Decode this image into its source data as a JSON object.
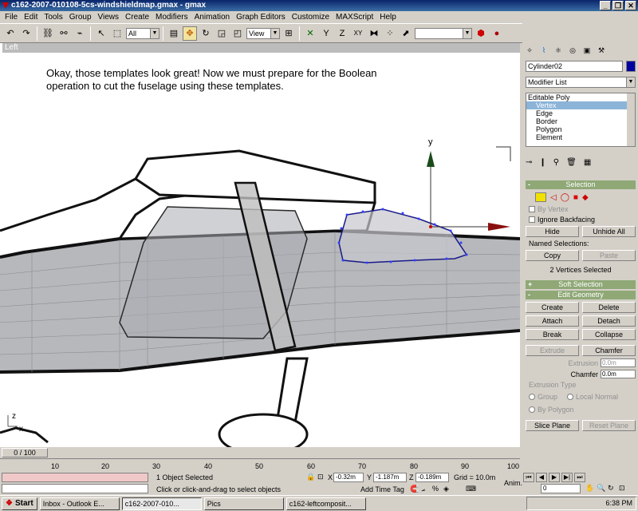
{
  "window": {
    "title": "c162-2007-010108-5cs-windshieldmap.gmax - gmax",
    "controls": [
      "_",
      "❐",
      "✕"
    ]
  },
  "menu": [
    "File",
    "Edit",
    "Tools",
    "Group",
    "Views",
    "Create",
    "Modifiers",
    "Animation",
    "Graph Editors",
    "Customize",
    "MAXScript",
    "Help"
  ],
  "toolbar": {
    "selection_filter": "All",
    "ref_coord": "View"
  },
  "viewport": {
    "label": "Left",
    "note": "Okay, those templates look great!  Now we must prepare for the Boolean operation to cut the fuselage using these templates.",
    "gizmo_y": "y",
    "axis_z": "z",
    "axis_x": "x"
  },
  "command_panel": {
    "object_name": "Cylinder02",
    "modifier_list": "Modifier List",
    "stack": [
      {
        "label": "Editable Poly",
        "selected": false,
        "top": true
      },
      {
        "label": "Vertex",
        "selected": true
      },
      {
        "label": "Edge",
        "selected": false
      },
      {
        "label": "Border",
        "selected": false
      },
      {
        "label": "Polygon",
        "selected": false
      },
      {
        "label": "Element",
        "selected": false
      }
    ],
    "selection": {
      "title": "Selection",
      "by_vertex": "By Vertex",
      "ignore_backfacing": "Ignore Backfacing",
      "hide": "Hide",
      "unhide_all": "Unhide All",
      "named_selections": "Named Selections:",
      "copy": "Copy",
      "paste": "Paste",
      "status": "2 Vertices Selected"
    },
    "soft_selection": "Soft Selection",
    "edit_geometry": {
      "title": "Edit Geometry",
      "create": "Create",
      "delete": "Delete",
      "attach": "Attach",
      "detach": "Detach",
      "break": "Break",
      "collapse": "Collapse",
      "extrude": "Extrude",
      "chamfer_btn": "Chamfer",
      "extrusion_label": "Extrusion",
      "extrusion_value": "0.0m",
      "chamfer_label": "Chamfer",
      "chamfer_value": "0.0m",
      "extrusion_type": "Extrusion Type",
      "group": "Group",
      "local_normal": "Local Normal",
      "by_polygon": "By Polygon",
      "slice_plane": "Slice Plane",
      "reset_plane": "Reset Plane"
    }
  },
  "timeline": {
    "frame": "0 / 100",
    "ticks": [
      "10",
      "20",
      "30",
      "40",
      "50",
      "60",
      "70",
      "80",
      "90",
      "100"
    ]
  },
  "status": {
    "selected": "1 Object Selected",
    "prompt": "Click or click-and-drag to select objects",
    "x_label": "X",
    "x": "-0.32m",
    "y_label": "Y",
    "y": "-1.187m",
    "z_label": "Z",
    "z": "-0.189m",
    "grid": "Grid = 10.0m",
    "add_time_tag": "Add Time Tag",
    "anim": "Anim.",
    "frame_field": "0"
  },
  "taskbar": {
    "start": "Start",
    "tasks": [
      {
        "label": "Inbox - Outlook E...",
        "active": false
      },
      {
        "label": "c162-2007-010...",
        "active": true
      },
      {
        "label": "Pics",
        "active": false
      },
      {
        "label": "c162-leftcomposit...",
        "active": false
      }
    ],
    "clock": "6:38 PM"
  }
}
